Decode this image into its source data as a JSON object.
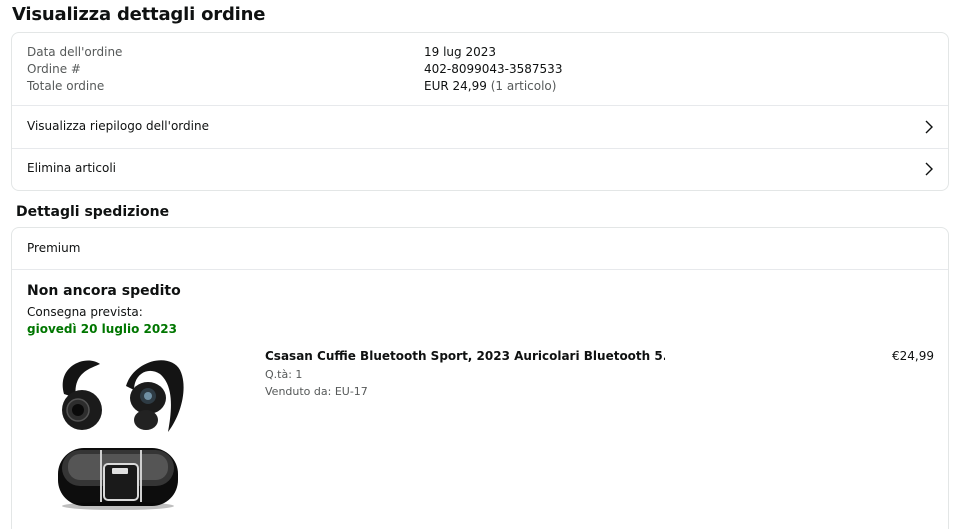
{
  "page_title": "Visualizza dettagli ordine",
  "order": {
    "date_label": "Data dell'ordine",
    "date_value": "19 lug 2023",
    "number_label": "Ordine #",
    "number_value": "402-8099043-3587533",
    "total_label": "Totale ordine",
    "total_value": "EUR 24,99",
    "total_items": "(1 articolo)",
    "links": [
      {
        "label": "Visualizza riepilogo dell'ordine",
        "icon": "chevron-right-icon"
      },
      {
        "label": "Elimina articoli",
        "icon": "chevron-right-icon"
      }
    ]
  },
  "shipping": {
    "section_title": "Dettagli spedizione",
    "service": "Premium",
    "status": "Non ancora spedito",
    "delivery_label": "Consegna prevista:",
    "delivery_date": "giovedì 20 luglio 2023",
    "delivery_color": "#007600",
    "item": {
      "name": "Csasan Cuffie Bluetooth Sport, 2023 Auricolari Bluetooth 5.3 con...",
      "qty": "Q.tà: 1",
      "seller": "Venduto da: EU-17",
      "price": "€24,99",
      "image_icon": "wireless-earbuds-product-image"
    }
  }
}
